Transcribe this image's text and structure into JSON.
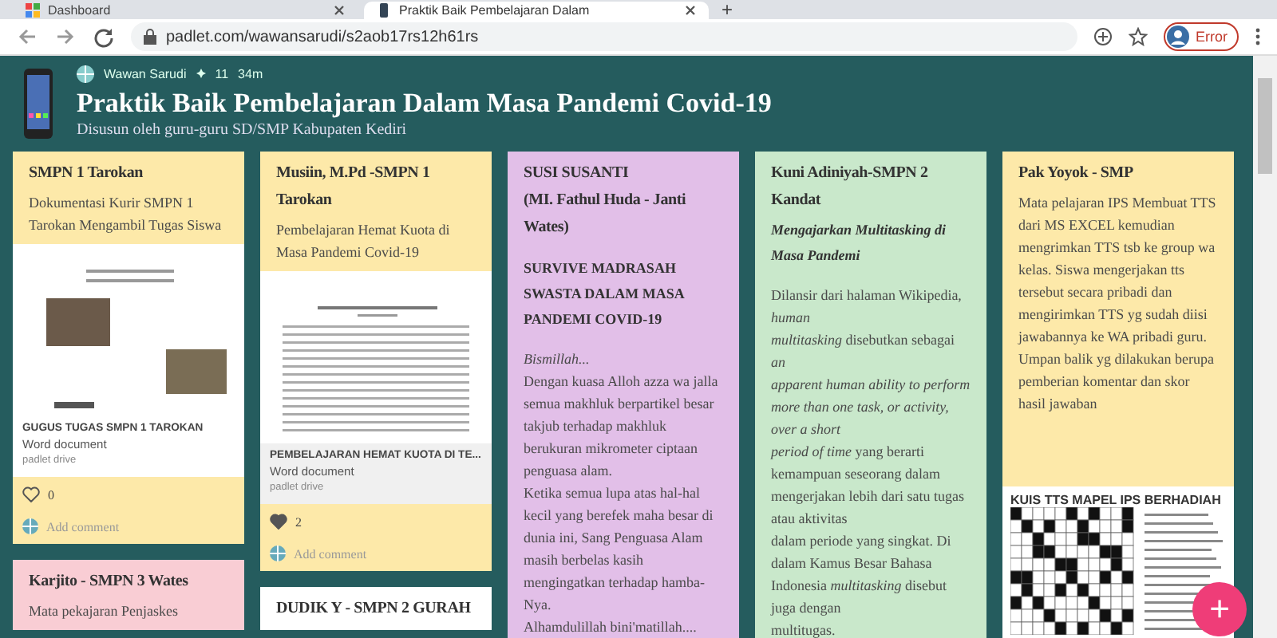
{
  "browser": {
    "tabs": [
      {
        "title": "Dashboard",
        "selected": false
      },
      {
        "title": "Praktik Baik Pembelajaran Dalam",
        "selected": true
      }
    ],
    "new_tab": "+",
    "url": "padlet.com/wawansarudi/s2aob17rs12h61rs",
    "profile_status": "Error"
  },
  "board": {
    "author": "Wawan Sarudi",
    "likes": "11",
    "age": "34m",
    "title": "Praktik Baik Pembelajaran Dalam Masa Pandemi Covid-19",
    "subtitle": "Disusun oleh guru-guru SD/SMP Kabupaten Kediri"
  },
  "columns": [
    [
      {
        "color": "#fde9a9",
        "title": [
          "SMPN 1 Tarokan"
        ],
        "body": [
          "Dokumentasi Kurir SMPN 1 Tarokan Mengambil Tugas Siswa"
        ],
        "attachment": {
          "kind": "document",
          "title": "GUGUS TUGAS SMPN 1 TAROKAN",
          "type": "Word document",
          "source": "padlet drive"
        },
        "reactions": {
          "liked": false,
          "count": "0"
        },
        "comment": "Add comment"
      },
      {
        "color": "#f9cdd4",
        "title": [
          "Karjito - SMPN 3 Wates"
        ],
        "body": [
          "Mata pekajaran Penjaskes"
        ]
      }
    ],
    [
      {
        "color": "#fde9a9",
        "title": [
          "Musiin, M.Pd -SMPN 1 Tarokan"
        ],
        "body": [
          "Pembelajaran Hemat Kuota di Masa Pandemi Covid-19"
        ],
        "attachment": {
          "kind": "document",
          "title": "PEMBELAJARAN HEMAT KUOTA DI TE...",
          "type": "Word document",
          "source": "padlet drive"
        },
        "reactions": {
          "liked": true,
          "count": "2"
        },
        "comment": "Add comment"
      },
      {
        "color": "#ffffff",
        "title": [
          "DUDIK Y - SMPN 2 GURAH"
        ]
      }
    ],
    [
      {
        "color": "#e2bfe8",
        "title": [
          "SUSI SUSANTI",
          "(MI. Fathul Huda - Janti Wates)"
        ],
        "subtitle": "SURVIVE MADRASAH SWASTA DALAM MASA PANDEMI COVID-19",
        "body": [
          "*Bismillah...*",
          "Dengan kuasa Alloh azza wa jalla semua makhluk berpartikel besar  takjub terhadap makhluk berukuran mikrometer ciptaan penguasa alam.",
          "Ketika semua lupa atas hal-hal kecil yang berefek maha besar di dunia ini, Sang Penguasa Alam masih berbelas kasih mengingatkan terhadap hamba-Nya.",
          "Alhamdulillah bini'matillah...."
        ]
      }
    ],
    [
      {
        "color": "#c9e8cb",
        "title": [
          "Kuni Adiniyah-SMPN 2 Kandat"
        ],
        "subtitle": "Mengajarkan Multitasking di Masa Pandemi",
        "subtitle_italic": true,
        "body": [
          "Dilansir dari halaman Wikipedia, *human*",
          "*multitasking* disebutkan sebagai *an*",
          "*apparent human ability to perform more than one task, or activity, over a short*",
          "*period of time* yang berarti kemampuan seseorang dalam mengerjakan lebih dari satu tugas atau aktivitas",
          "dalam periode yang singkat. Di dalam Kamus Besar Bahasa Indonesia *multitasking* disebut juga dengan",
          "multitugas."
        ]
      }
    ],
    [
      {
        "color": "#fde9a9",
        "title": [
          "Pak Yoyok - SMP"
        ],
        "body": [
          "Mata pelajaran IPS Membuat TTS dari MS EXCEL kemudian mengrimkan TTS tsb ke group wa kelas. Siswa mengerjakan tts tersebut secara pribadi dan mengirimkan TTS yg sudah diisi jawabannya ke WA pribadi guru. Umpan balik yg dilakukan berupa pemberian komentar dan skor hasil jawaban"
        ],
        "attachment": {
          "kind": "crossword",
          "title": "KUIS TTS MAPEL IPS BERHADIAH"
        }
      }
    ]
  ],
  "add_button": "+"
}
